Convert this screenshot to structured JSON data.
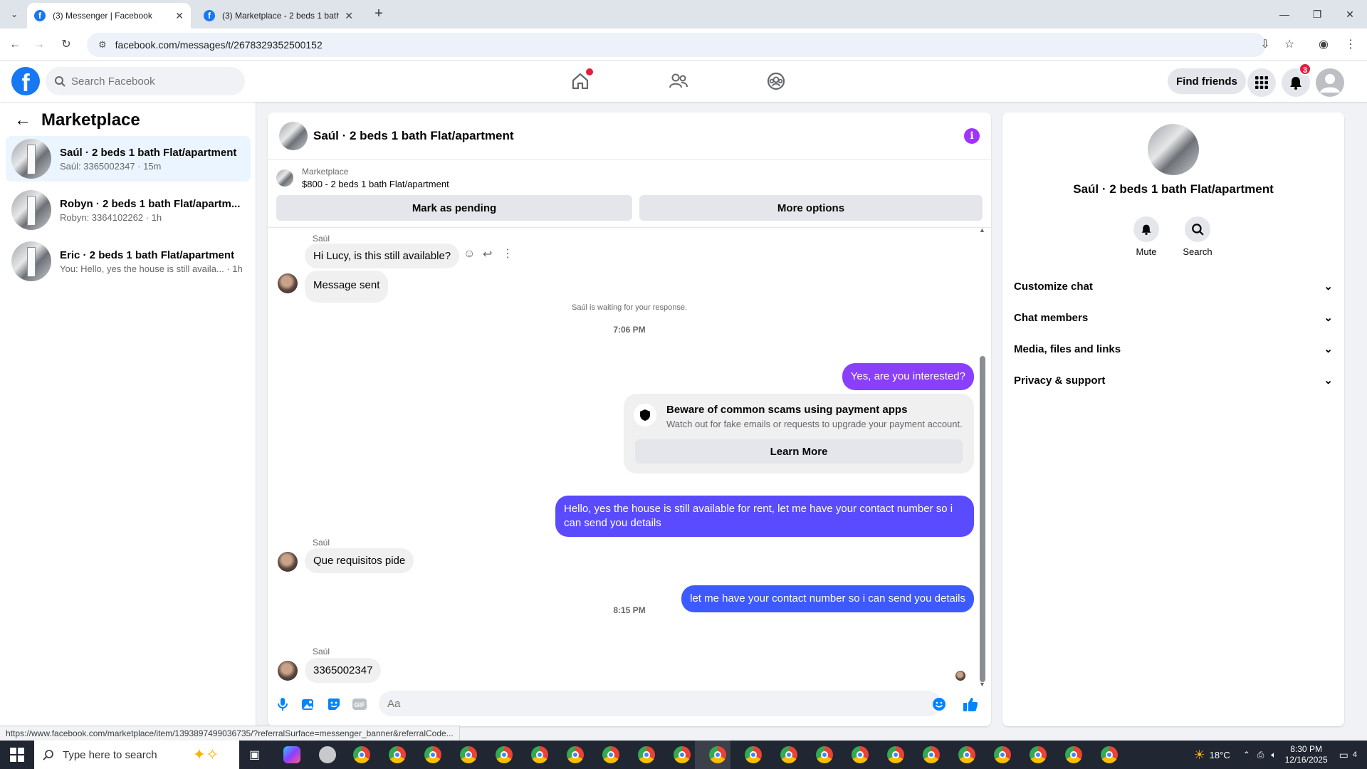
{
  "browser": {
    "tabs": [
      {
        "title": "(3) Messenger | Facebook",
        "active": true
      },
      {
        "title": "(3) Marketplace - 2 beds 1 bath",
        "active": false
      }
    ],
    "url": "facebook.com/messages/t/2678329352500152"
  },
  "header": {
    "search_placeholder": "Search Facebook",
    "find_friends": "Find friends",
    "notifications_count": "3",
    "icons": [
      "facebook-logo",
      "home-icon",
      "friends-icon",
      "groups-icon",
      "menu-grid-icon",
      "bell-icon",
      "account-icon"
    ]
  },
  "sidebar": {
    "title": "Marketplace",
    "conversations": [
      {
        "name": "Saúl · 2 beds 1 bath Flat/apartment",
        "preview": "Saúl: 3365002347 · 15m",
        "active": true
      },
      {
        "name": "Robyn · 2 beds 1 bath Flat/apartm...",
        "preview": "Robyn: 3364102262 · 1h",
        "active": false
      },
      {
        "name": "Eric · 2 beds 1 bath Flat/apartment",
        "preview": "You: Hello, yes the house is still availa... · 1h",
        "active": false
      }
    ]
  },
  "chat": {
    "title": "Saúl · 2 beds 1 bath Flat/apartment",
    "listing_label": "Marketplace",
    "listing_value": "$800 - 2 beds 1 bath Flat/apartment",
    "mark_pending": "Mark as pending",
    "more_options": "More options",
    "sender": "Saúl",
    "msg1": "Hi Lucy, is this still available?",
    "msg2": "Message sent",
    "waiting": "Saúl is waiting for your response.",
    "time1": "7:06 PM",
    "out1": "Yes, are you interested?",
    "warning_title": "Beware of common scams using payment apps",
    "warning_desc": "Watch out for fake emails or requests to upgrade your payment account.",
    "learn_more": "Learn More",
    "out2": "Hello, yes the house is still available for rent, let me have your contact number so i can send you details",
    "msg3": "Que requisitos pide",
    "out3": "let me have your contact number so i can send you details",
    "time2": "8:15 PM",
    "msg4": "3365002347",
    "composer_placeholder": "Aa",
    "colors": {
      "out_purple": "#8a3ffc",
      "out_blue": "#3d5afe",
      "like_blue": "#0084ff"
    }
  },
  "right_panel": {
    "title": "Saúl · 2 beds 1 bath Flat/apartment",
    "mute": "Mute",
    "search": "Search",
    "sections": [
      "Customize chat",
      "Chat members",
      "Media, files and links",
      "Privacy & support"
    ]
  },
  "status_url": "https://www.facebook.com/marketplace/item/1393897499036735/?referralSurface=messenger_banner&referralCode...",
  "taskbar": {
    "search_placeholder": "Type here to search",
    "weather": "18°C",
    "time": "8:30 PM",
    "date": "12/16/2025",
    "notif_count": "4"
  }
}
